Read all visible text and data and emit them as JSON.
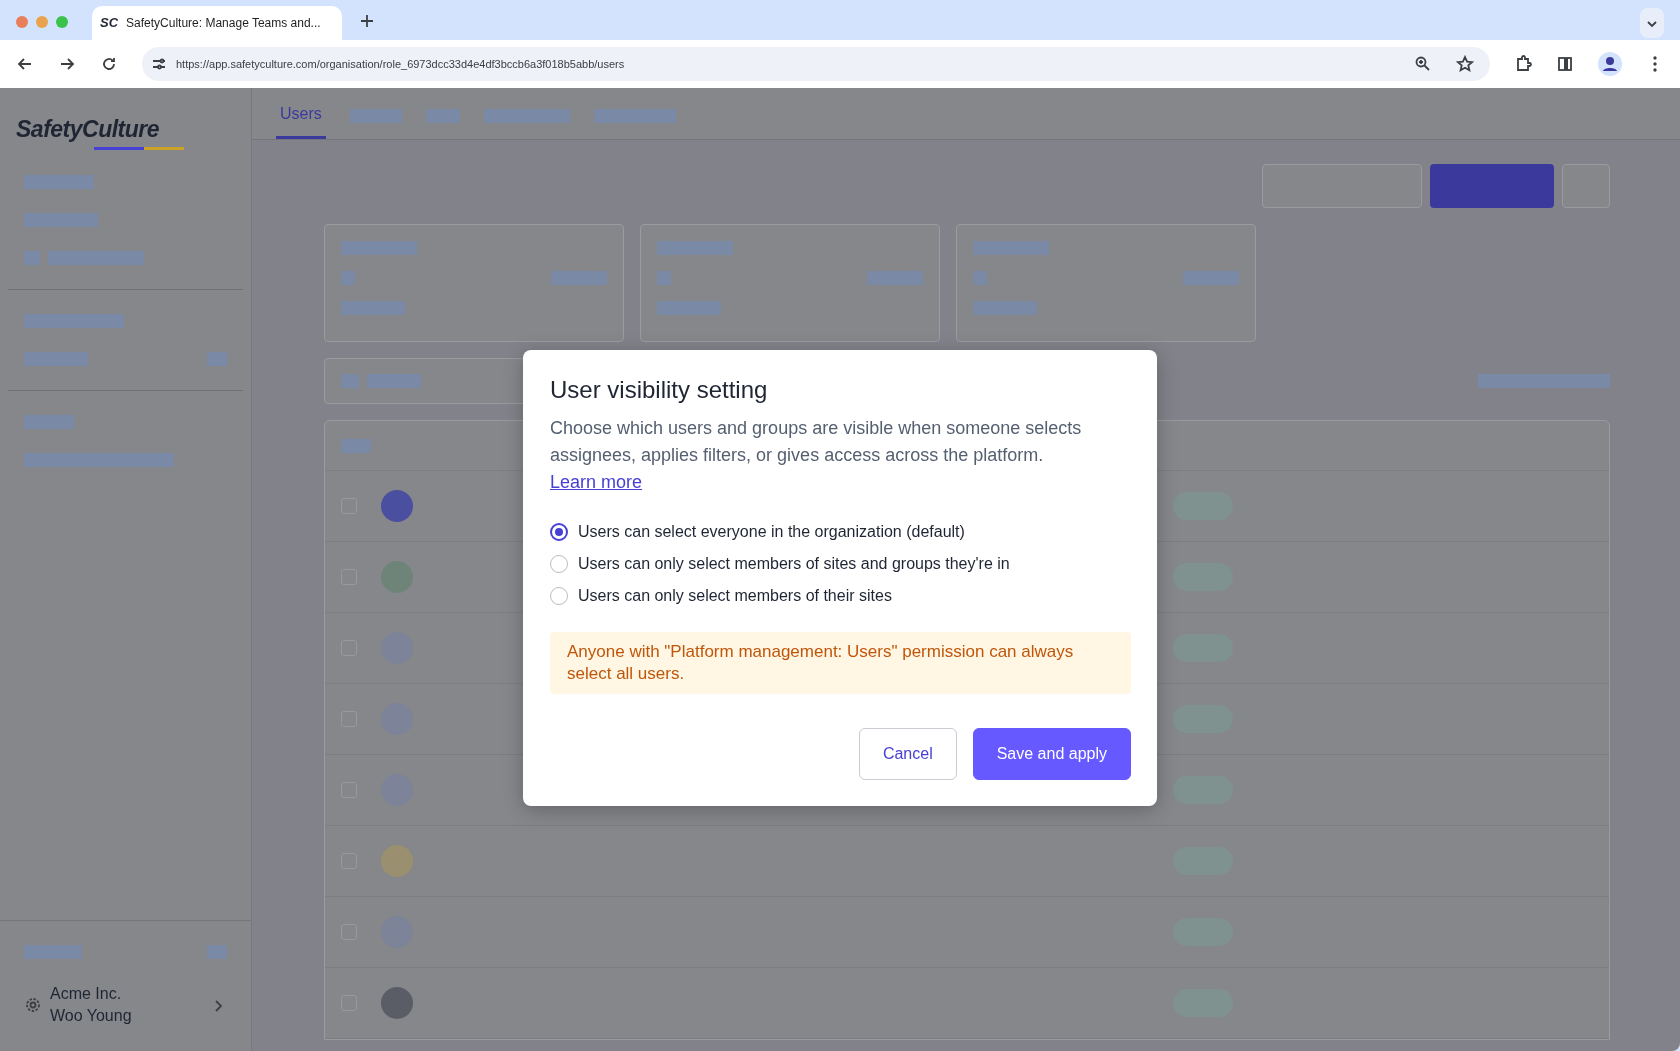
{
  "browser": {
    "favicon_text": "SC",
    "tab_title": "SafetyCulture: Manage Teams and...",
    "url": "https://app.safetyculture.com/organisation/role_6973dcc33d4e4df3bccb6a3f018b5abb/users"
  },
  "sidebar": {
    "logo": "SafetyCulture",
    "organization": "Acme Inc.",
    "user": "Woo Young"
  },
  "tabs": [
    {
      "label": "Users",
      "selected": true
    }
  ],
  "table": {
    "rows": [
      {
        "checked": false
      },
      {
        "checked": false
      },
      {
        "checked": false
      },
      {
        "checked": false
      },
      {
        "checked": false
      },
      {
        "checked": false
      },
      {
        "checked": false
      },
      {
        "checked": false
      }
    ]
  },
  "dialog": {
    "title": "User visibility setting",
    "description": "Choose which users and groups are visible when someone selects assignees, applies filters, or gives access across the platform.",
    "link": "Learn more",
    "options": [
      {
        "label": "Users can select everyone in the organization (default)",
        "selected": true
      },
      {
        "label": "Users can only select members of sites and groups they're in",
        "selected": false
      },
      {
        "label": "Users can only select members of their sites",
        "selected": false
      }
    ],
    "notice": "Anyone with \"Platform management: Users\" permission can always select all users.",
    "buttons": [
      {
        "label": "Cancel",
        "kind": "secondary"
      },
      {
        "label": "Save and apply",
        "kind": "primary"
      }
    ]
  }
}
